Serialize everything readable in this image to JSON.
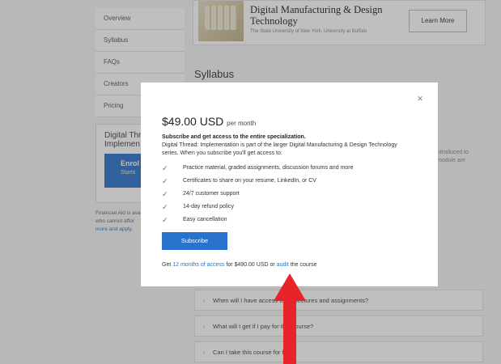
{
  "sidebar": {
    "items": [
      {
        "label": "Overview"
      },
      {
        "label": "Syllabus"
      },
      {
        "label": "FAQs"
      },
      {
        "label": "Creators"
      },
      {
        "label": "Pricing"
      }
    ],
    "box_title_line1": "Digital Thre",
    "box_title_line2": "Implemen",
    "enroll_label": "Enrol",
    "enroll_sub": "Starts",
    "fin_aid_line1": "Financial Aid is ava",
    "fin_aid_line2": "who cannot affor",
    "fin_aid_link": "more and apply."
  },
  "hero": {
    "title": "Digital Manufacturing & Design Technology",
    "subtitle": "The State University of New York, University at Buffalo",
    "learn_more": "Learn More"
  },
  "section_title": "Syllabus",
  "right_fragments": [
    "ntroduced to",
    "module are"
  ],
  "faqs": [
    {
      "chevron": "›",
      "question": "When will I have access to the lectures and assignments?"
    },
    {
      "chevron": "›",
      "question": "What will I get if I pay for this course?"
    },
    {
      "chevron": "›",
      "question": "Can I take this course for free?"
    }
  ],
  "modal": {
    "price": "$49.00 USD",
    "per": "per month",
    "sub_head": "Subscribe and get access to the entire specialization.",
    "desc": "Digital Thread: Implementation is part of the larger Digital Manufacturing & Design Technology series. When you subscribe you'll get access to:",
    "benefits": [
      "Practice material, graded assignments, discussion forums and more",
      "Certificates to share on your resume, LinkedIn, or CV",
      "24/7 customer support",
      "14-day refund policy",
      "Easy cancellation"
    ],
    "subscribe_label": "Subscribe",
    "foot_pre": "Get",
    "foot_link": "12 months of access",
    "foot_mid": "for $490.00 USD or",
    "audit_link": "audit",
    "foot_post": "the course",
    "close_glyph": "×",
    "check_glyph": "✓"
  },
  "colors": {
    "accent": "#2a73cc",
    "arrow": "#e8242a"
  }
}
